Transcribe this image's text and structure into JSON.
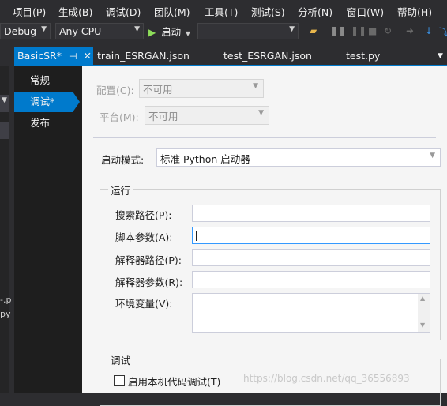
{
  "menu": {
    "items": [
      "项目(P)",
      "生成(B)",
      "调试(D)",
      "团队(M)",
      "工具(T)",
      "测试(S)",
      "分析(N)",
      "窗口(W)",
      "帮助(H)"
    ]
  },
  "toolbar": {
    "config_value": "Debug",
    "platform_value": "Any CPU",
    "start_label": "启动",
    "start_icon": "play-icon"
  },
  "tabs": [
    {
      "label": "BasicSR*",
      "active": true
    },
    {
      "label": "train_ESRGAN.json",
      "active": false
    },
    {
      "label": "test_ESRGAN.json",
      "active": false
    },
    {
      "label": "test.py",
      "active": false
    }
  ],
  "left_panel": {
    "fragment_1": "-.p",
    "fragment_2": "py"
  },
  "nav": {
    "items": [
      "常规",
      "调试*",
      "发布"
    ],
    "selected_index": 1
  },
  "config": {
    "config_label": "配置(C):",
    "config_value": "不可用",
    "platform_label": "平台(M):",
    "platform_value": "不可用"
  },
  "launch": {
    "mode_label": "启动模式:",
    "mode_value": "标准 Python 启动器"
  },
  "run_group": {
    "title": "运行",
    "search_path_label": "搜索路径(P):",
    "search_path_value": "",
    "script_args_label": "脚本参数(A):",
    "script_args_value": "",
    "interp_path_label": "解释器路径(P):",
    "interp_path_value": "",
    "interp_args_label": "解释器参数(R):",
    "interp_args_value": "",
    "env_label": "环境变量(V):",
    "env_value": ""
  },
  "debug_group": {
    "title": "调试",
    "native_debug_label": "启用本机代码调试(T)",
    "native_debug_checked": false
  },
  "watermark": "https://blog.csdn.net/qq_36556893",
  "colors": {
    "accent": "#007acc",
    "chrome": "#2d2d30",
    "page_bg": "#f5f5f5"
  }
}
